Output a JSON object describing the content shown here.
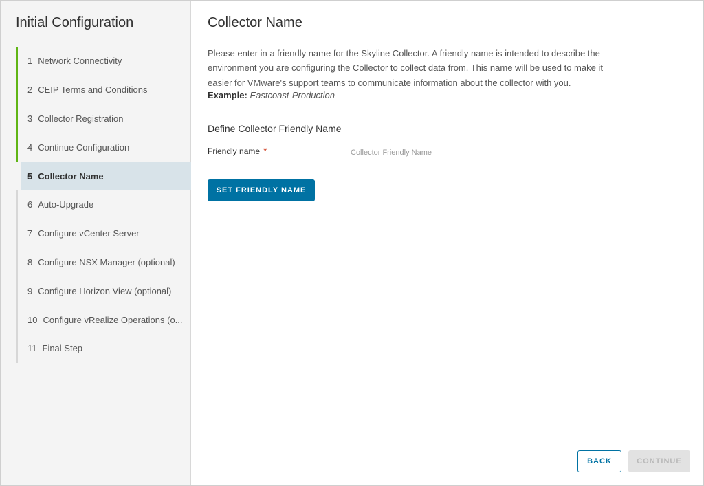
{
  "sidebar": {
    "title": "Initial Configuration",
    "steps": [
      {
        "num": "1",
        "label": "Network Connectivity",
        "state": "done"
      },
      {
        "num": "2",
        "label": "CEIP Terms and Conditions",
        "state": "done"
      },
      {
        "num": "3",
        "label": "Collector Registration",
        "state": "done"
      },
      {
        "num": "4",
        "label": "Continue Configuration",
        "state": "done"
      },
      {
        "num": "5",
        "label": "Collector Name",
        "state": "current"
      },
      {
        "num": "6",
        "label": "Auto-Upgrade",
        "state": "pending"
      },
      {
        "num": "7",
        "label": "Configure vCenter Server",
        "state": "pending"
      },
      {
        "num": "8",
        "label": "Configure NSX Manager (optional)",
        "state": "pending"
      },
      {
        "num": "9",
        "label": "Configure Horizon View (optional)",
        "state": "pending"
      },
      {
        "num": "10",
        "label": "Configure vRealize Operations (o...",
        "state": "pending"
      },
      {
        "num": "11",
        "label": "Final Step",
        "state": "pending"
      }
    ]
  },
  "main": {
    "title": "Collector Name",
    "description": "Please enter in a friendly name for the Skyline Collector. A friendly name is intended to describe the environment you are configuring the Collector to collect data from. This name will be used to make it easier for VMware's support teams to communicate information about the collector with you.",
    "example_label": "Example:",
    "example_value": "Eastcoast-Production",
    "section_title": "Define Collector Friendly Name",
    "field_label": "Friendly name",
    "required_mark": "*",
    "field_value": "",
    "field_placeholder": "Collector Friendly Name",
    "set_button": "SET FRIENDLY NAME",
    "back_button": "BACK",
    "continue_button": "CONTINUE"
  },
  "colors": {
    "done": "#60b515",
    "pending": "#d7d7d7",
    "current_bg": "#d8e3e9",
    "primary": "#0072a3",
    "disabled_bg": "#e2e2e2"
  }
}
